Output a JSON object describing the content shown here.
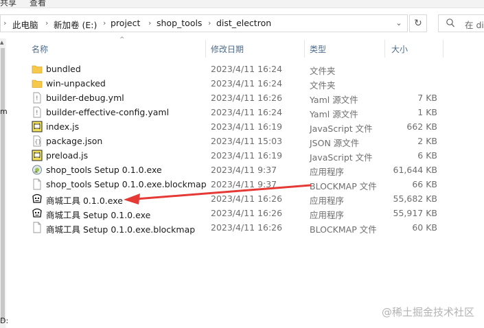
{
  "ribbon": {
    "tab_share": "共享",
    "tab_view": "查看"
  },
  "address": {
    "crumbs": [
      "此电脑",
      "新加卷 (E:)",
      "project",
      "shop_tools",
      "dist_electron"
    ],
    "dropdown_icon": "chevron-down-icon",
    "refresh_icon": "refresh-icon"
  },
  "search": {
    "placeholder": "在 dist_electron 中搜索",
    "visible_text": "在 di"
  },
  "nav_fragments": [
    "m",
    "D:"
  ],
  "columns": {
    "name": "名称",
    "date": "修改日期",
    "type": "类型",
    "size": "大小"
  },
  "files": [
    {
      "icon": "folder-icon",
      "name": "bundled",
      "date": "2023/4/11 16:24",
      "type": "文件夹",
      "size": ""
    },
    {
      "icon": "folder-icon",
      "name": "win-unpacked",
      "date": "2023/4/11 16:24",
      "type": "文件夹",
      "size": ""
    },
    {
      "icon": "yaml-file-icon",
      "name": "builder-debug.yml",
      "date": "2023/4/11 16:26",
      "type": "Yaml 源文件",
      "size": "7 KB"
    },
    {
      "icon": "yaml-file-icon",
      "name": "builder-effective-config.yaml",
      "date": "2023/4/11 16:24",
      "type": "Yaml 源文件",
      "size": "1 KB"
    },
    {
      "icon": "js-file-icon",
      "name": "index.js",
      "date": "2023/4/11 16:19",
      "type": "JavaScript 文件",
      "size": "662 KB"
    },
    {
      "icon": "json-file-icon",
      "name": "package.json",
      "date": "2023/4/11 15:03",
      "type": "JSON 源文件",
      "size": "2 KB"
    },
    {
      "icon": "js-file-icon",
      "name": "preload.js",
      "date": "2023/4/11 16:19",
      "type": "JavaScript 文件",
      "size": "6 KB"
    },
    {
      "icon": "installer-icon",
      "name": "shop_tools Setup 0.1.0.exe",
      "date": "2023/4/11 9:37",
      "type": "应用程序",
      "size": "61,644 KB"
    },
    {
      "icon": "blank-file-icon",
      "name": "shop_tools Setup 0.1.0.exe.blockmap",
      "date": "2023/4/11 9:37",
      "type": "BLOCKMAP 文件",
      "size": "66 KB"
    },
    {
      "icon": "app-exe-icon",
      "name": "商城工具 0.1.0.exe",
      "date": "2023/4/11 16:26",
      "type": "应用程序",
      "size": "55,682 KB"
    },
    {
      "icon": "app-exe-icon",
      "name": "商城工具 Setup 0.1.0.exe",
      "date": "2023/4/11 16:26",
      "type": "应用程序",
      "size": "55,917 KB"
    },
    {
      "icon": "blank-file-icon",
      "name": "商城工具 Setup 0.1.0.exe.blockmap",
      "date": "2023/4/11 16:26",
      "type": "BLOCKMAP 文件",
      "size": "60 KB"
    }
  ],
  "annotation": {
    "color": "#e53935",
    "points_to": "商城工具 0.1.0.exe"
  },
  "watermark": "@稀土掘金技术社区"
}
